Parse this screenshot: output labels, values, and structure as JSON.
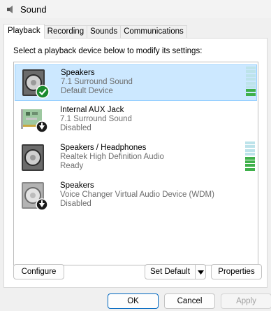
{
  "window": {
    "title": "Sound"
  },
  "tabs": [
    "Playback",
    "Recording",
    "Sounds",
    "Communications"
  ],
  "instruction": "Select a playback device below to modify its settings:",
  "devices": [
    {
      "name": "Speakers",
      "line2": "7.1 Surround Sound",
      "line3": "Default Device",
      "selected": true,
      "status_icon": "check-icon",
      "meter_level": 0.25
    },
    {
      "name": "Internal AUX Jack",
      "line2": "7.1 Surround Sound",
      "line3": "Disabled",
      "selected": false,
      "status_icon": "down-arrow-icon"
    },
    {
      "name": "Speakers / Headphones",
      "line2": "Realtek High Definition Audio",
      "line3": "Ready",
      "selected": false,
      "meter_level": 0.4
    },
    {
      "name": "Speakers",
      "line2": "Voice Changer Virtual Audio Device (WDM)",
      "line3": "Disabled",
      "selected": false,
      "status_icon": "down-arrow-icon"
    }
  ],
  "buttons": {
    "configure": "Configure",
    "set_default": "Set Default",
    "properties": "Properties",
    "ok": "OK",
    "cancel": "Cancel",
    "apply": "Apply"
  },
  "colors": {
    "selection": "#cce8ff",
    "meter_active": "#3fb04a",
    "meter_idle": "#bde3ea",
    "default_check": "#1b8a2e"
  }
}
